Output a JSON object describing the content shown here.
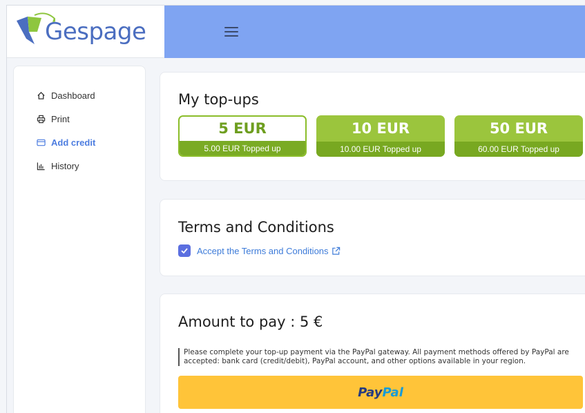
{
  "brand": {
    "name": "Gespage"
  },
  "sidebar": {
    "items": [
      {
        "label": "Dashboard",
        "icon": "home-icon"
      },
      {
        "label": "Print",
        "icon": "printer-icon"
      },
      {
        "label": "Add credit",
        "icon": "credit-card-icon",
        "active": true
      },
      {
        "label": "History",
        "icon": "bar-chart-icon"
      }
    ]
  },
  "topups": {
    "title": "My top-ups",
    "options": [
      {
        "amount": "5 EUR",
        "caption": "5.00 EUR Topped up",
        "selected": true
      },
      {
        "amount": "10 EUR",
        "caption": "10.00 EUR Topped up"
      },
      {
        "amount": "50 EUR",
        "caption": "60.00 EUR Topped up"
      }
    ]
  },
  "terms": {
    "title": "Terms and Conditions",
    "checkbox_label": "Accept the Terms and Conditions",
    "checked": true
  },
  "payment": {
    "title": "Amount to pay : 5 €",
    "notice": "Please complete your top-up payment via the PayPal gateway. All payment methods offered by PayPal are accepted: bank card (credit/debit), PayPal account, and other options available in your region.",
    "paypal_part1": "Pay",
    "paypal_part2": "Pal"
  },
  "colors": {
    "topbar": "#7fa4f2",
    "accent_green": "#9bc53d",
    "link_blue": "#3d7bd9",
    "paypal_yellow": "#ffc439"
  }
}
